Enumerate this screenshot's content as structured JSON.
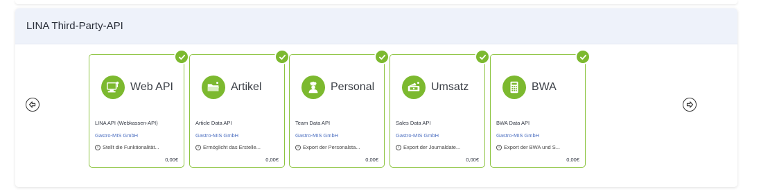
{
  "panel": {
    "title": "LINA Third-Party-API"
  },
  "cards": [
    {
      "name": "Web API",
      "icon": "computer-icon",
      "api": "LINA API (Webkassen-API)",
      "vendor": "Gastro-MIS GmbH",
      "desc": "Stellt die Funktionalität...",
      "price": "0,00€"
    },
    {
      "name": "Artikel",
      "icon": "folder-icon",
      "api": "Article Data API",
      "vendor": "Gastro-MIS GmbH",
      "desc": "Ermöglicht das Erstelle...",
      "price": "0,00€"
    },
    {
      "name": "Personal",
      "icon": "chef-icon",
      "api": "Team Data API",
      "vendor": "Gastro-MIS GmbH",
      "desc": "Export der Personalsta...",
      "price": "0,00€"
    },
    {
      "name": "Umsatz",
      "icon": "cash-register-icon",
      "api": "Sales Data API",
      "vendor": "Gastro-MIS GmbH",
      "desc": "Export der Journaldate...",
      "price": "0,00€"
    },
    {
      "name": "BWA",
      "icon": "calculator-icon",
      "api": "BWA Data API",
      "vendor": "Gastro-MIS GmbH",
      "desc": "Export der BWA und S...",
      "price": "0,00€"
    }
  ],
  "colors": {
    "accent": "#7cb92f",
    "border": "#8cc43f",
    "vendor": "#4c6fc0",
    "header_bg": "#eef2fa"
  }
}
